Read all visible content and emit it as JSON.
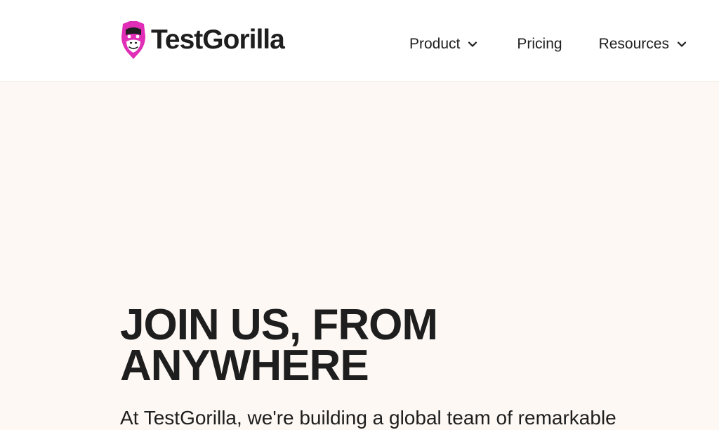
{
  "brand": {
    "name": "TestGorilla",
    "accent_color": "#e02fb6",
    "logo_icon": "gorilla-face-icon"
  },
  "nav": {
    "items": [
      {
        "label": "Product",
        "has_dropdown": true,
        "icon": "chevron-down-icon"
      },
      {
        "label": "Pricing",
        "has_dropdown": false
      },
      {
        "label": "Resources",
        "has_dropdown": true,
        "icon": "chevron-down-icon"
      }
    ]
  },
  "hero": {
    "title_line1": "JOIN US, FROM",
    "title_line2": "ANYWHERE",
    "subtitle": "At TestGorilla, we're building a global team of remarkable"
  },
  "colors": {
    "header_bg": "#ffffff",
    "page_bg": "#fdf8f4",
    "text": "#1e1e1e"
  }
}
